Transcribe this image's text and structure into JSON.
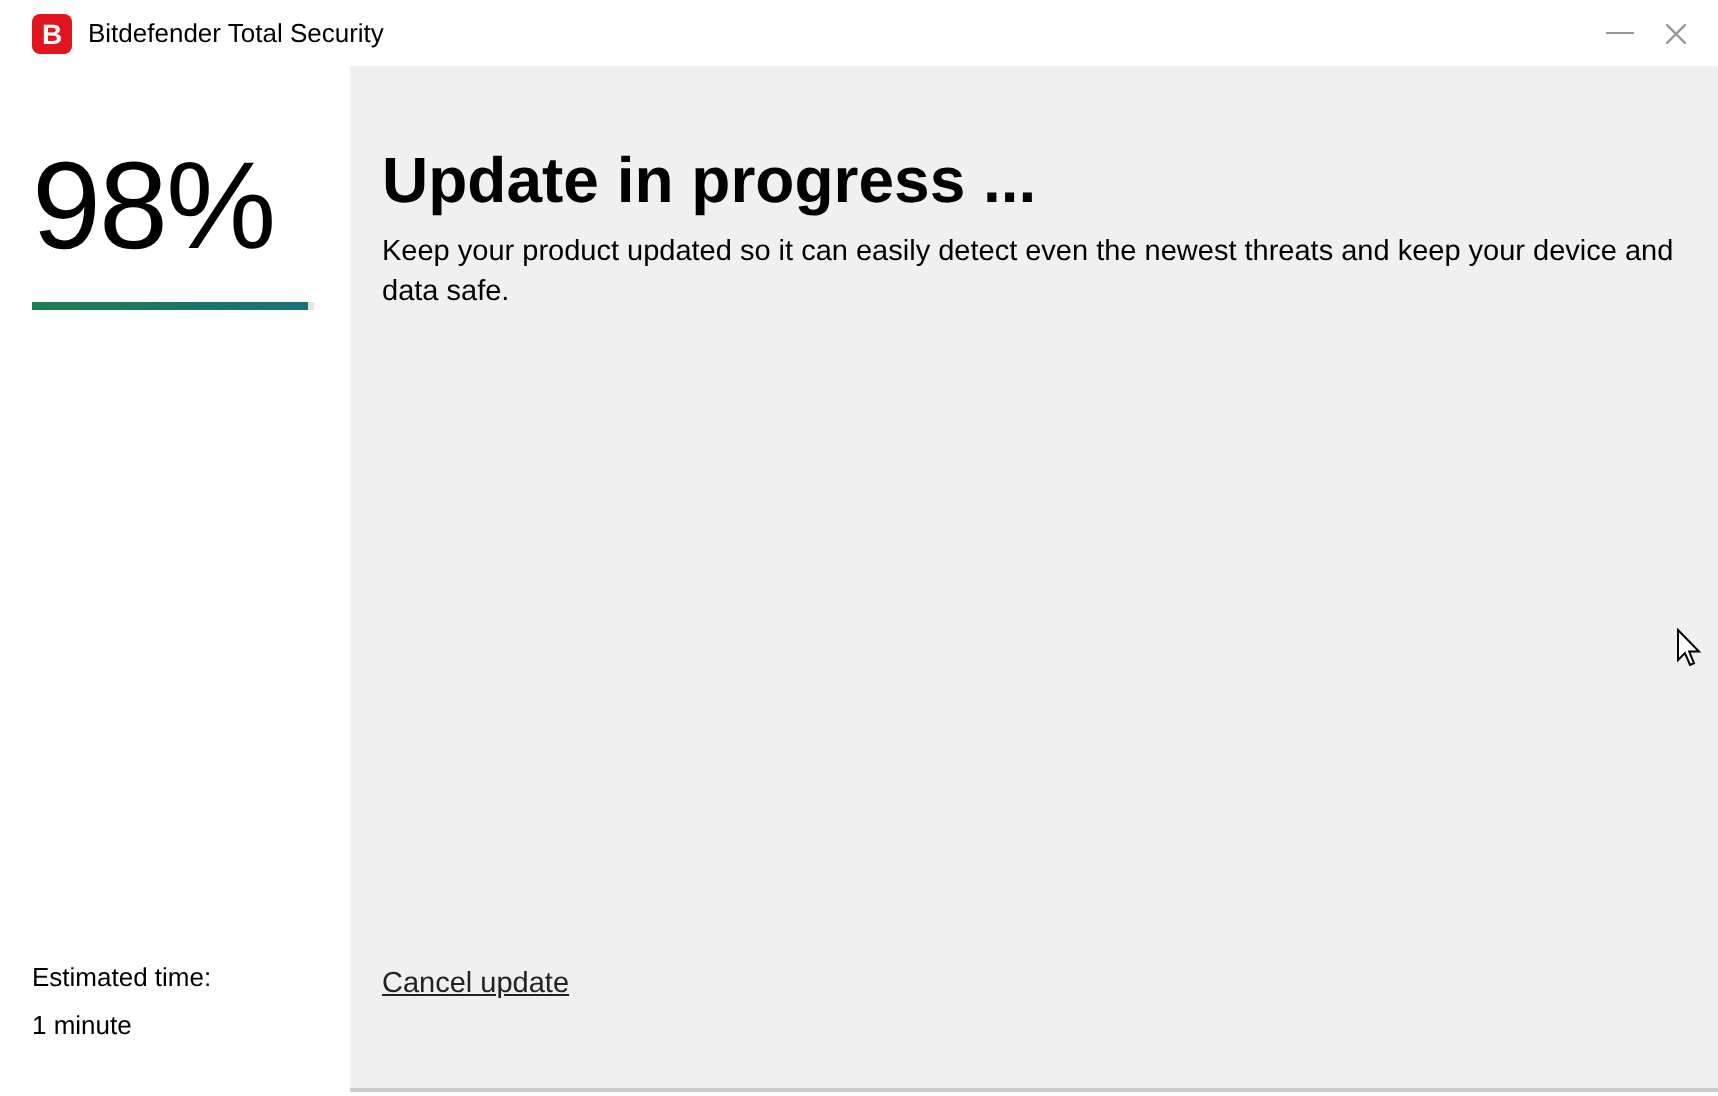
{
  "window": {
    "title": "Bitdefender Total Security",
    "logo": "B"
  },
  "progress": {
    "percent": "98%",
    "level": 0.98,
    "estimated_label": "Estimated time:",
    "estimated_value": "1 minute"
  },
  "main": {
    "heading": "Update in progress ...",
    "description": "Keep your product updated so it can easily detect even the newest threats and keep your device and data safe.",
    "cancel_link": "Cancel update"
  }
}
